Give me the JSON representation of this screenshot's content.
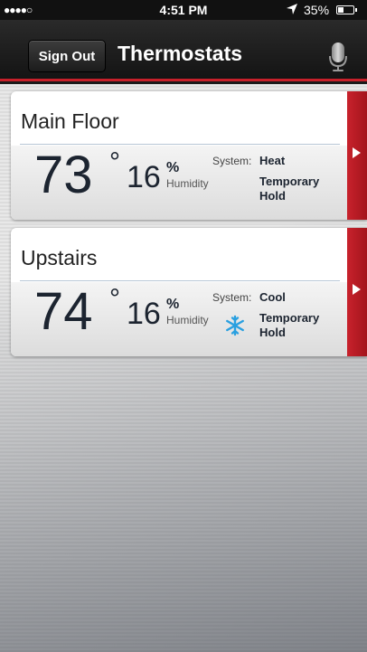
{
  "status_bar": {
    "signal": "●●●●○",
    "time": "4:51 PM",
    "location_icon": "location-arrow-icon",
    "battery_percent": "35%",
    "battery_level": 0.35
  },
  "nav": {
    "sign_out_label": "Sign Out",
    "title": "Thermostats",
    "mic_icon": "microphone-icon"
  },
  "thermostats": [
    {
      "name": "Main Floor",
      "temperature": "73",
      "degree": "°",
      "humidity": "16",
      "humidity_unit": "%",
      "humidity_label": "Humidity",
      "system_label": "System:",
      "system_mode": "Heat",
      "hold_line1": "Temporary",
      "hold_line2": "Hold",
      "mode_icon": ""
    },
    {
      "name": "Upstairs",
      "temperature": "74",
      "degree": "°",
      "humidity": "16",
      "humidity_unit": "%",
      "humidity_label": "Humidity",
      "system_label": "System:",
      "system_mode": "Cool",
      "hold_line1": "Temporary",
      "hold_line2": "Hold",
      "mode_icon": "snowflake-icon"
    }
  ],
  "colors": {
    "accent_red": "#c8202a",
    "cool_blue": "#2aa0e0"
  }
}
